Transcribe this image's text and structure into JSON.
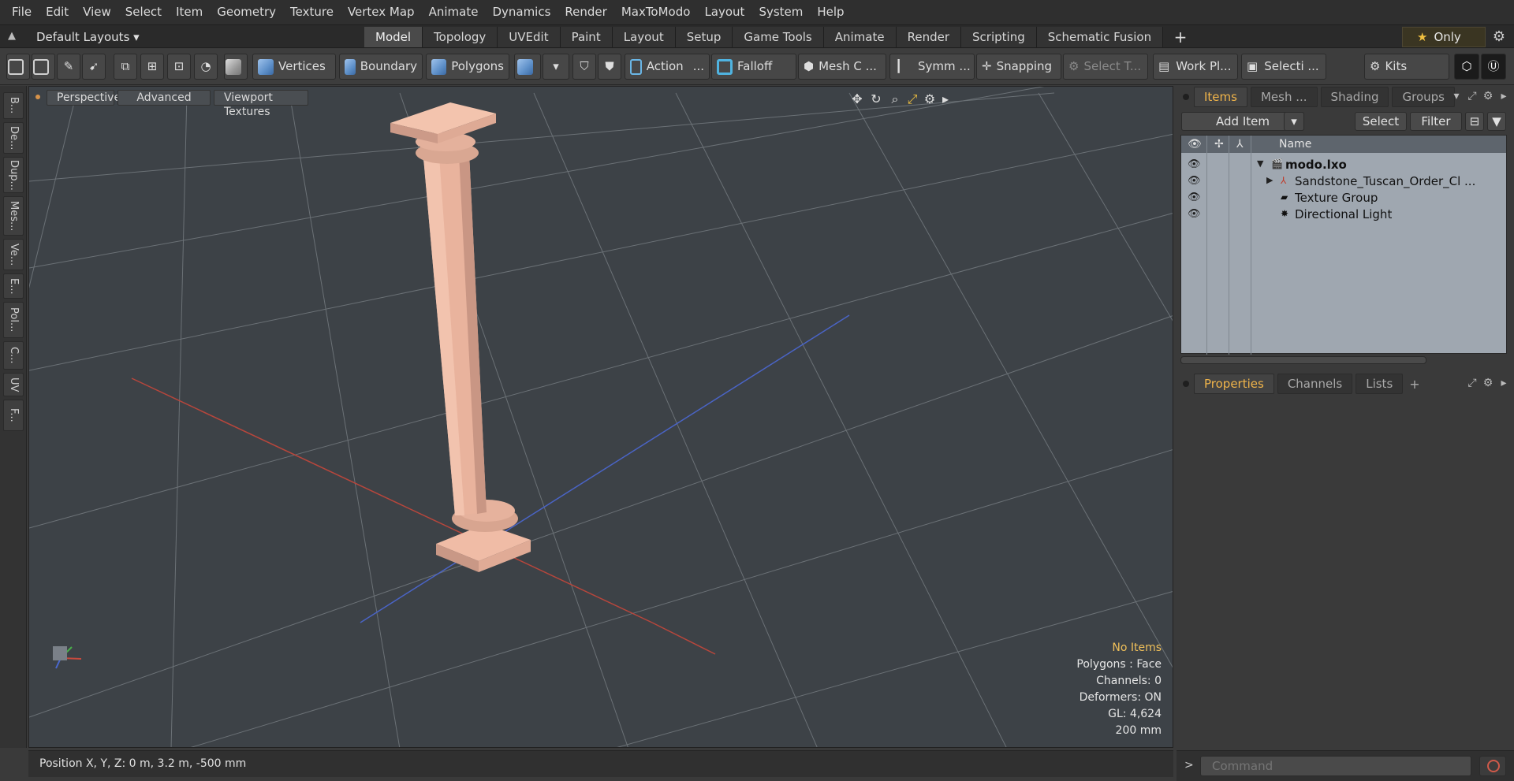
{
  "menu": [
    "File",
    "Edit",
    "View",
    "Select",
    "Item",
    "Geometry",
    "Texture",
    "Vertex Map",
    "Animate",
    "Dynamics",
    "Render",
    "MaxToModo",
    "Layout",
    "System",
    "Help"
  ],
  "layout": {
    "selector": "Default Layouts ▾",
    "tabs": [
      "Model",
      "Topology",
      "UVEdit",
      "Paint",
      "Layout",
      "Setup",
      "Game Tools",
      "Animate",
      "Render",
      "Scripting",
      "Schematic Fusion"
    ],
    "active_tab": "Model",
    "add_tab": "+",
    "only": "Only"
  },
  "toolbar": {
    "vertices": "Vertices",
    "boundary": "Boundary",
    "polygons": "Polygons",
    "action": "Action",
    "action_more": "...",
    "falloff": "Falloff",
    "mesh": "Mesh C ...",
    "symm": "Symm ...",
    "snapping": "Snapping",
    "select_t": "Select T...",
    "workplane": "Work Pl...",
    "selection": "Selecti ...",
    "kits": "Kits"
  },
  "left_tabs": [
    "B...",
    "De...",
    "Dup...",
    "Mes...",
    "Ve...",
    "E...",
    "Pol...",
    "C...",
    "UV",
    "F..."
  ],
  "viewport": {
    "buttons": [
      "Perspective",
      "Advanced",
      "Viewport Textures"
    ],
    "info": {
      "selection": "No Items",
      "polygons": "Polygons : Face",
      "channels": "Channels: 0",
      "deformers": "Deformers: ON",
      "gl": "GL: 4,624",
      "scale": "200 mm"
    }
  },
  "items_panel": {
    "tabs": [
      "Items",
      "Mesh ...",
      "Shading",
      "Groups"
    ],
    "active_tab": "Items",
    "add_item": "Add Item",
    "select": "Select",
    "filter": "Filter",
    "header_name": "Name",
    "rows": [
      {
        "label": "modo.lxo",
        "bold": true
      },
      {
        "label": "Sandstone_Tuscan_Order_Cl ...",
        "bold": false
      },
      {
        "label": "Texture Group",
        "bold": false
      },
      {
        "label": "Directional Light",
        "bold": false
      }
    ]
  },
  "props_panel": {
    "tabs": [
      "Properties",
      "Channels",
      "Lists"
    ],
    "active_tab": "Properties",
    "add": "+"
  },
  "status": {
    "position": "Position X, Y, Z:   0 m, 3.2 m, -500 mm"
  },
  "command": {
    "placeholder": "Command"
  },
  "colors": {
    "accent": "#f0b44a",
    "column": "#e7b29a",
    "x_axis": "#c0453a",
    "z_axis": "#4a66c8"
  }
}
